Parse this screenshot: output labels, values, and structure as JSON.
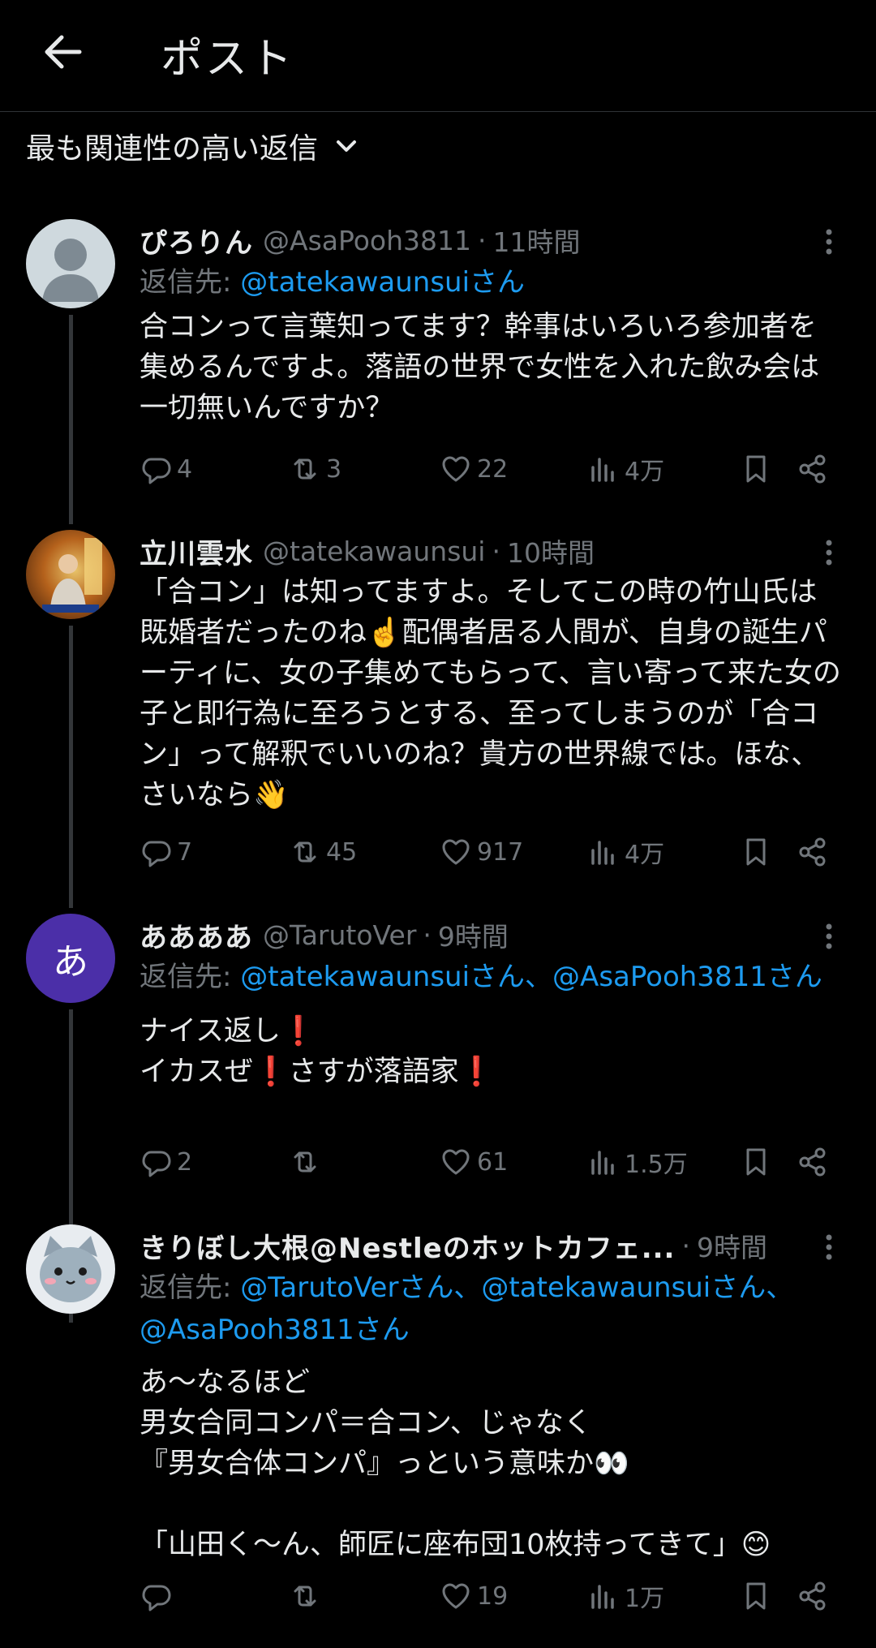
{
  "header": {
    "title": "ポスト"
  },
  "sort": {
    "label": "最も関連性の高い返信"
  },
  "replies": [
    {
      "name": "ぴろりん",
      "handle": "@AsaPooh3811",
      "time": "11時間",
      "replyto_prefix": "返信先: ",
      "replyto_mentions": "@tatekawaunsuiさん",
      "text": "合コンって言葉知ってます？幹事はいろいろ参加者を集めるんですよ。落語の世界で女性を入れた飲み会は一切無いんですか？",
      "replies": "4",
      "reposts": "3",
      "likes": "22",
      "views": "4万",
      "avatar_icon": "default-person-avatar"
    },
    {
      "name": "立川雲水",
      "handle": "@tatekawaunsui",
      "time": "10時間",
      "text": "「合コン」は知ってますよ。そしてこの時の竹山氏は既婚者だったのね☝️配偶者居る人間が、自身の誕生パーティに、女の子集めてもらって、言い寄って来た女の子と即行為に至ろうとする、至ってしまうのが「合コン」って解釈でいいのね？貴方の世界線では。ほな、さいなら👋",
      "replies": "7",
      "reposts": "45",
      "likes": "917",
      "views": "4万",
      "avatar_icon": "rakugo-performer-photo"
    },
    {
      "name": "ああああ",
      "handle": "@TarutoVer",
      "time": "9時間",
      "replyto_prefix": "返信先: ",
      "replyto_mentions": "@tatekawaunsuiさん、@AsaPooh3811さん",
      "text": "ナイス返し❗\nイカスぜ❗さすが落語家❗",
      "replies": "2",
      "reposts": "",
      "likes": "61",
      "views": "1.5万",
      "avatar_letter": "あ",
      "avatar_color": "#4b2fa8"
    },
    {
      "name": "きりぼし大根@Nestleのホットカフェ...",
      "handle": "",
      "time": "9時間",
      "replyto_prefix": "返信先: ",
      "replyto_mentions": "@TarutoVerさん、@tatekawaunsuiさん、@AsaPooh3811さん",
      "text": "あ〜なるほど\n男女合同コンパ＝合コン、じゃなく\n『男女合体コンパ』っという意味か👀\n\n「山田く〜ん、師匠に座布団10枚持ってきて」😊",
      "replies": "",
      "reposts": "",
      "likes": "19",
      "views": "1万",
      "avatar_icon": "cat-character-avatar"
    }
  ],
  "colors": {
    "background": "#000000",
    "text": "#e7e9ea",
    "muted": "#71767b",
    "link": "#1d9bf0",
    "divider": "#2f3336"
  },
  "icons": [
    "back-arrow-icon",
    "chevron-down-icon",
    "more-icon",
    "reply-icon",
    "repost-icon",
    "like-icon",
    "views-icon",
    "bookmark-icon",
    "share-icon"
  ]
}
